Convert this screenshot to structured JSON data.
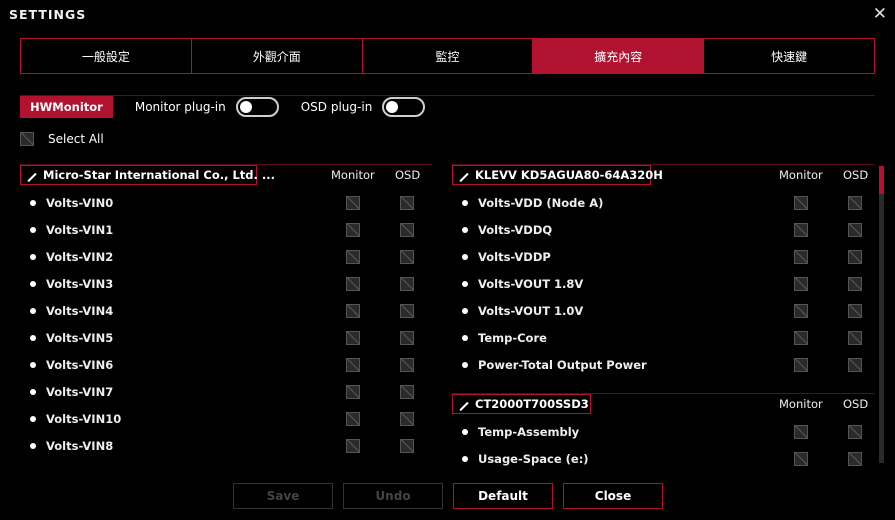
{
  "window": {
    "title": "SETTINGS",
    "close_glyph": "✕"
  },
  "tabs": [
    {
      "label": "一般設定",
      "active": false
    },
    {
      "label": "外觀介面",
      "active": false
    },
    {
      "label": "監控",
      "active": false
    },
    {
      "label": "擴充內容",
      "active": true
    },
    {
      "label": "快速鍵",
      "active": false
    }
  ],
  "subbar": {
    "hwmonitor_label": "HWMonitor",
    "monitor_plugin_label": "Monitor plug-in",
    "monitor_plugin_on": false,
    "osd_plugin_label": "OSD plug-in",
    "osd_plugin_on": false
  },
  "select_all": {
    "label": "Select All",
    "checked": false
  },
  "columns": {
    "monitor": "Monitor",
    "osd": "OSD"
  },
  "groups": {
    "msi": {
      "title": "Micro-Star International Co., Ltd. ...",
      "items": [
        "Volts-VIN0",
        "Volts-VIN1",
        "Volts-VIN2",
        "Volts-VIN3",
        "Volts-VIN4",
        "Volts-VIN5",
        "Volts-VIN6",
        "Volts-VIN7",
        "Volts-VIN10",
        "Volts-VIN8"
      ]
    },
    "klevv": {
      "title": "KLEVV KD5AGUA80-64A320H",
      "items": [
        "Volts-VDD (Node A)",
        "Volts-VDDQ",
        "Volts-VDDP",
        "Volts-VOUT 1.8V",
        "Volts-VOUT 1.0V",
        "Temp-Core",
        "Power-Total Output Power"
      ]
    },
    "ssd": {
      "title": "CT2000T700SSD3",
      "items": [
        "Temp-Assembly",
        "Usage-Space (e:)"
      ]
    }
  },
  "buttons": {
    "save": "Save",
    "undo": "Undo",
    "default": "Default",
    "close": "Close"
  },
  "colors": {
    "accent": "#b0122f",
    "background": "#000000"
  }
}
